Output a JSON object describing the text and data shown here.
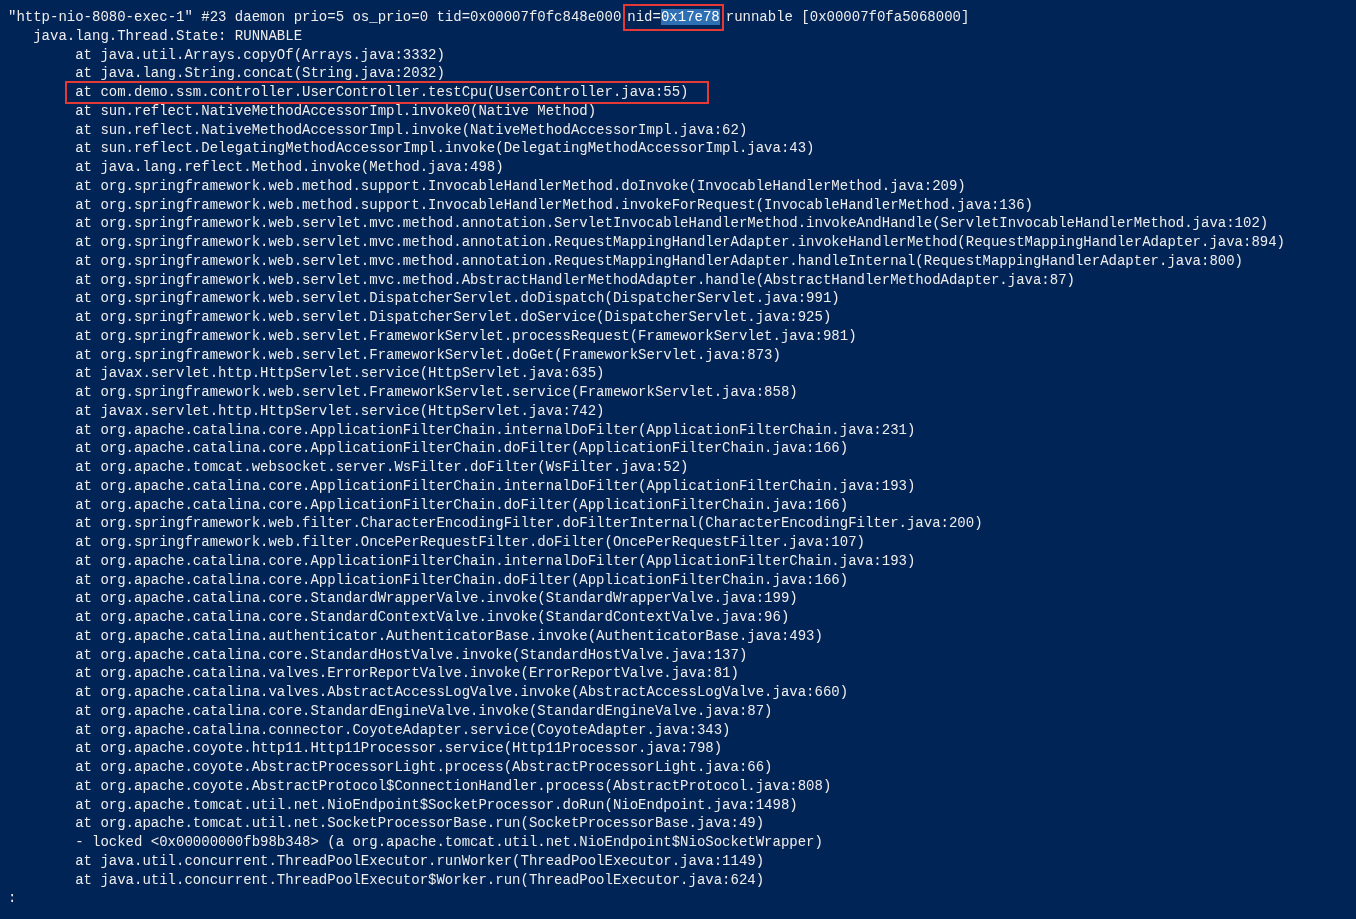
{
  "header": {
    "text_before": "\"http-nio-8080-exec-1\" #23 daemon prio=5 os_prio=0 tid=0x00007f0fc848e000",
    "boxed_label": "nid=",
    "selected_text": "0x17e78",
    "text_after": "runnable [0x00007f0fa5068000]"
  },
  "lines": [
    {
      "kind": "state",
      "text": "java.lang.Thread.State: RUNNABLE",
      "highlighted": false
    },
    {
      "kind": "frame",
      "text": "at java.util.Arrays.copyOf(Arrays.java:3332)",
      "highlighted": false
    },
    {
      "kind": "frame",
      "text": "at java.lang.String.concat(String.java:2032)",
      "highlighted": false
    },
    {
      "kind": "frame",
      "text": "at com.demo.ssm.controller.UserController.testCpu(UserController.java:55)",
      "highlighted": true
    },
    {
      "kind": "frame",
      "text": "at sun.reflect.NativeMethodAccessorImpl.invoke0(Native Method)",
      "highlighted": false
    },
    {
      "kind": "frame",
      "text": "at sun.reflect.NativeMethodAccessorImpl.invoke(NativeMethodAccessorImpl.java:62)",
      "highlighted": false
    },
    {
      "kind": "frame",
      "text": "at sun.reflect.DelegatingMethodAccessorImpl.invoke(DelegatingMethodAccessorImpl.java:43)",
      "highlighted": false
    },
    {
      "kind": "frame",
      "text": "at java.lang.reflect.Method.invoke(Method.java:498)",
      "highlighted": false
    },
    {
      "kind": "frame",
      "text": "at org.springframework.web.method.support.InvocableHandlerMethod.doInvoke(InvocableHandlerMethod.java:209)",
      "highlighted": false
    },
    {
      "kind": "frame",
      "text": "at org.springframework.web.method.support.InvocableHandlerMethod.invokeForRequest(InvocableHandlerMethod.java:136)",
      "highlighted": false
    },
    {
      "kind": "frame",
      "text": "at org.springframework.web.servlet.mvc.method.annotation.ServletInvocableHandlerMethod.invokeAndHandle(ServletInvocableHandlerMethod.java:102)",
      "highlighted": false
    },
    {
      "kind": "frame",
      "text": "at org.springframework.web.servlet.mvc.method.annotation.RequestMappingHandlerAdapter.invokeHandlerMethod(RequestMappingHandlerAdapter.java:894)",
      "highlighted": false
    },
    {
      "kind": "frame",
      "text": "at org.springframework.web.servlet.mvc.method.annotation.RequestMappingHandlerAdapter.handleInternal(RequestMappingHandlerAdapter.java:800)",
      "highlighted": false
    },
    {
      "kind": "frame",
      "text": "at org.springframework.web.servlet.mvc.method.AbstractHandlerMethodAdapter.handle(AbstractHandlerMethodAdapter.java:87)",
      "highlighted": false
    },
    {
      "kind": "frame",
      "text": "at org.springframework.web.servlet.DispatcherServlet.doDispatch(DispatcherServlet.java:991)",
      "highlighted": false
    },
    {
      "kind": "frame",
      "text": "at org.springframework.web.servlet.DispatcherServlet.doService(DispatcherServlet.java:925)",
      "highlighted": false
    },
    {
      "kind": "frame",
      "text": "at org.springframework.web.servlet.FrameworkServlet.processRequest(FrameworkServlet.java:981)",
      "highlighted": false
    },
    {
      "kind": "frame",
      "text": "at org.springframework.web.servlet.FrameworkServlet.doGet(FrameworkServlet.java:873)",
      "highlighted": false
    },
    {
      "kind": "frame",
      "text": "at javax.servlet.http.HttpServlet.service(HttpServlet.java:635)",
      "highlighted": false
    },
    {
      "kind": "frame",
      "text": "at org.springframework.web.servlet.FrameworkServlet.service(FrameworkServlet.java:858)",
      "highlighted": false
    },
    {
      "kind": "frame",
      "text": "at javax.servlet.http.HttpServlet.service(HttpServlet.java:742)",
      "highlighted": false
    },
    {
      "kind": "frame",
      "text": "at org.apache.catalina.core.ApplicationFilterChain.internalDoFilter(ApplicationFilterChain.java:231)",
      "highlighted": false
    },
    {
      "kind": "frame",
      "text": "at org.apache.catalina.core.ApplicationFilterChain.doFilter(ApplicationFilterChain.java:166)",
      "highlighted": false
    },
    {
      "kind": "frame",
      "text": "at org.apache.tomcat.websocket.server.WsFilter.doFilter(WsFilter.java:52)",
      "highlighted": false
    },
    {
      "kind": "frame",
      "text": "at org.apache.catalina.core.ApplicationFilterChain.internalDoFilter(ApplicationFilterChain.java:193)",
      "highlighted": false
    },
    {
      "kind": "frame",
      "text": "at org.apache.catalina.core.ApplicationFilterChain.doFilter(ApplicationFilterChain.java:166)",
      "highlighted": false
    },
    {
      "kind": "frame",
      "text": "at org.springframework.web.filter.CharacterEncodingFilter.doFilterInternal(CharacterEncodingFilter.java:200)",
      "highlighted": false
    },
    {
      "kind": "frame",
      "text": "at org.springframework.web.filter.OncePerRequestFilter.doFilter(OncePerRequestFilter.java:107)",
      "highlighted": false
    },
    {
      "kind": "frame",
      "text": "at org.apache.catalina.core.ApplicationFilterChain.internalDoFilter(ApplicationFilterChain.java:193)",
      "highlighted": false
    },
    {
      "kind": "frame",
      "text": "at org.apache.catalina.core.ApplicationFilterChain.doFilter(ApplicationFilterChain.java:166)",
      "highlighted": false
    },
    {
      "kind": "frame",
      "text": "at org.apache.catalina.core.StandardWrapperValve.invoke(StandardWrapperValve.java:199)",
      "highlighted": false
    },
    {
      "kind": "frame",
      "text": "at org.apache.catalina.core.StandardContextValve.invoke(StandardContextValve.java:96)",
      "highlighted": false
    },
    {
      "kind": "frame",
      "text": "at org.apache.catalina.authenticator.AuthenticatorBase.invoke(AuthenticatorBase.java:493)",
      "highlighted": false
    },
    {
      "kind": "frame",
      "text": "at org.apache.catalina.core.StandardHostValve.invoke(StandardHostValve.java:137)",
      "highlighted": false
    },
    {
      "kind": "frame",
      "text": "at org.apache.catalina.valves.ErrorReportValve.invoke(ErrorReportValve.java:81)",
      "highlighted": false
    },
    {
      "kind": "frame",
      "text": "at org.apache.catalina.valves.AbstractAccessLogValve.invoke(AbstractAccessLogValve.java:660)",
      "highlighted": false
    },
    {
      "kind": "frame",
      "text": "at org.apache.catalina.core.StandardEngineValve.invoke(StandardEngineValve.java:87)",
      "highlighted": false
    },
    {
      "kind": "frame",
      "text": "at org.apache.catalina.connector.CoyoteAdapter.service(CoyoteAdapter.java:343)",
      "highlighted": false
    },
    {
      "kind": "frame",
      "text": "at org.apache.coyote.http11.Http11Processor.service(Http11Processor.java:798)",
      "highlighted": false
    },
    {
      "kind": "frame",
      "text": "at org.apache.coyote.AbstractProcessorLight.process(AbstractProcessorLight.java:66)",
      "highlighted": false
    },
    {
      "kind": "frame",
      "text": "at org.apache.coyote.AbstractProtocol$ConnectionHandler.process(AbstractProtocol.java:808)",
      "highlighted": false
    },
    {
      "kind": "frame",
      "text": "at org.apache.tomcat.util.net.NioEndpoint$SocketProcessor.doRun(NioEndpoint.java:1498)",
      "highlighted": false
    },
    {
      "kind": "frame",
      "text": "at org.apache.tomcat.util.net.SocketProcessorBase.run(SocketProcessorBase.java:49)",
      "highlighted": false
    },
    {
      "kind": "lock",
      "text": "- locked <0x00000000fb98b348> (a org.apache.tomcat.util.net.NioEndpoint$NioSocketWrapper)",
      "highlighted": false
    },
    {
      "kind": "frame",
      "text": "at java.util.concurrent.ThreadPoolExecutor.runWorker(ThreadPoolExecutor.java:1149)",
      "highlighted": false
    },
    {
      "kind": "frame",
      "text": "at java.util.concurrent.ThreadPoolExecutor$Worker.run(ThreadPoolExecutor.java:624)",
      "highlighted": false
    },
    {
      "kind": "prompt",
      "text": ":",
      "highlighted": false
    }
  ]
}
